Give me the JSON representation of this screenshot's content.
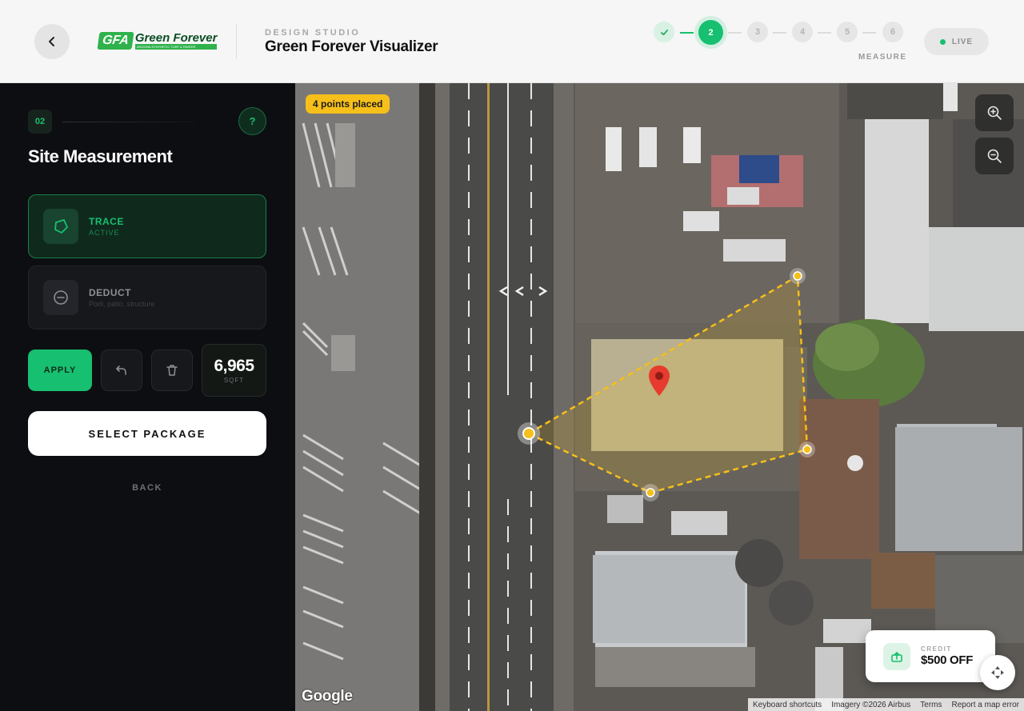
{
  "header": {
    "brand_mark": "GFA",
    "brand_name": "Green Forever",
    "brand_tagline": "ARIZONA SYNTHETIC TURF & PAVERS",
    "eyebrow": "DESIGN STUDIO",
    "title": "Green Forever Visualizer",
    "steps": [
      {
        "label": "",
        "state": "done"
      },
      {
        "label": "2",
        "state": "active"
      },
      {
        "label": "3",
        "state": "pending"
      },
      {
        "label": "4",
        "state": "pending"
      },
      {
        "label": "5",
        "state": "pending"
      },
      {
        "label": "6",
        "state": "pending"
      }
    ],
    "current_step_label": "MEASURE",
    "live_label": "LIVE"
  },
  "sidebar": {
    "step_number": "02",
    "help_label": "?",
    "title": "Site Measurement",
    "tools": {
      "trace": {
        "name": "TRACE",
        "sub": "ACTIVE"
      },
      "deduct": {
        "name": "DEDUCT",
        "sub": "Pool, patio, structure"
      }
    },
    "apply_label": "APPLY",
    "area_value": "6,965",
    "area_unit": "SQFT",
    "select_package_label": "SELECT PACKAGE",
    "back_label": "BACK"
  },
  "map": {
    "points_badge": "4 points placed",
    "credit_label": "CREDIT",
    "credit_value": "$500 OFF",
    "google_logo": "Google",
    "attribution": {
      "shortcuts": "Keyboard shortcuts",
      "imagery": "Imagery ©2026 Airbus",
      "terms": "Terms",
      "report": "Report a map error"
    }
  },
  "colors": {
    "accent": "#17c070",
    "sidebar_bg": "#0d0e12",
    "polygon": "#f6bf1a",
    "pin": "#e63b2e"
  }
}
